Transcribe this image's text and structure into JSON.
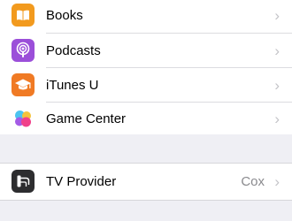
{
  "apps": [
    {
      "label": "Books",
      "icon": "books-icon",
      "color": "#f29a1e"
    },
    {
      "label": "Podcasts",
      "icon": "podcasts-icon",
      "color": "#9b4fd9"
    },
    {
      "label": "iTunes U",
      "icon": "itunes-u-icon",
      "color": "#f07a24"
    },
    {
      "label": "Game Center",
      "icon": "game-center-icon",
      "color": "#ffffff"
    }
  ],
  "tv_provider": {
    "label": "TV Provider",
    "value": "Cox",
    "icon": "tv-provider-icon",
    "color": "#2d2d2f"
  },
  "chevron": "›"
}
